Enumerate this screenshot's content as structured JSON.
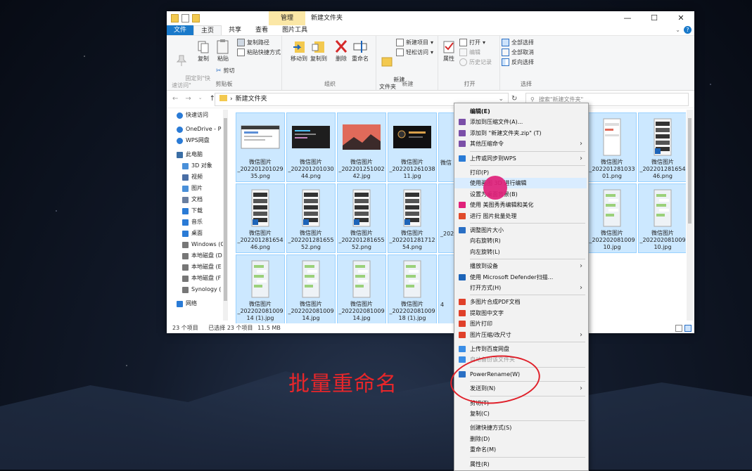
{
  "window": {
    "manage_tab": "管理",
    "title": "新建文件夹",
    "controls": [
      "—",
      "☐",
      "✕"
    ]
  },
  "tabs": {
    "file": "文件",
    "home": "主页",
    "share": "共享",
    "view": "查看",
    "picture_tools": "图片工具"
  },
  "ribbon": {
    "pin_quick": "固定到\"快\n速访问\"",
    "copy": "复制",
    "paste": "粘贴",
    "copy_path": "复制路径",
    "paste_shortcut": "粘贴快捷方式",
    "cut": "剪切",
    "clipboard_group": "剪贴板",
    "move_to": "移动到",
    "copy_to": "复制到",
    "delete": "删除",
    "rename": "重命名",
    "organize_group": "组织",
    "new_item": "新建项目",
    "easy_access": "轻松访问",
    "new_folder": "新建\n文件夹",
    "new_group": "新建",
    "properties": "属性",
    "open": "打开",
    "edit": "编辑",
    "history": "历史记录",
    "open_group": "打开",
    "select_all": "全部选择",
    "select_none": "全部取消",
    "invert_selection": "反向选择",
    "select_group": "选择"
  },
  "navbar": {
    "path": "新建文件夹",
    "search_placeholder": "搜索\"新建文件夹\""
  },
  "nav_pane": [
    {
      "label": "快速访问",
      "icon": "star-icon",
      "color": "#2a7bd6"
    },
    {
      "label": "OneDrive - P",
      "icon": "cloud-icon",
      "color": "#2a7bd6"
    },
    {
      "label": "WPS网盘",
      "icon": "cloud-icon",
      "color": "#2a7bd6"
    },
    {
      "label": "此电脑",
      "icon": "computer-icon",
      "color": "#3a6ea5"
    },
    {
      "label": "3D 对象",
      "icon": "cube-icon",
      "color": "#4a90d9"
    },
    {
      "label": "视频",
      "icon": "video-icon",
      "color": "#4a6ea5"
    },
    {
      "label": "图片",
      "icon": "picture-icon",
      "color": "#4a90d9"
    },
    {
      "label": "文档",
      "icon": "document-icon",
      "color": "#6a7fa0"
    },
    {
      "label": "下载",
      "icon": "download-icon",
      "color": "#2a7bd6"
    },
    {
      "label": "音乐",
      "icon": "music-icon",
      "color": "#2a7bd6"
    },
    {
      "label": "桌面",
      "icon": "desktop-icon",
      "color": "#2a7bd6"
    },
    {
      "label": "Windows (C",
      "icon": "drive-icon",
      "color": "#777"
    },
    {
      "label": "本地磁盘 (D",
      "icon": "drive-icon",
      "color": "#777"
    },
    {
      "label": "本地磁盘 (E",
      "icon": "drive-icon",
      "color": "#777"
    },
    {
      "label": "本地磁盘 (F",
      "icon": "drive-icon",
      "color": "#777"
    },
    {
      "label": "Synology (",
      "icon": "nas-icon",
      "color": "#777"
    },
    {
      "label": "网络",
      "icon": "network-icon",
      "color": "#2a7bd6"
    }
  ],
  "files": [
    {
      "name": "微信图片\n_202201201029\n35.png",
      "thumb": "screenshot"
    },
    {
      "name": "微信图片\n_202201201030\n44.png",
      "thumb": "dark"
    },
    {
      "name": "微信图片\n_202201251002\n42.jpg",
      "thumb": "red"
    },
    {
      "name": "微信图片\n_202201261038\n11.jpg",
      "thumb": "black"
    },
    {
      "name": "微信图片\n_202201281033\n01.png",
      "thumb": "phone-light"
    },
    {
      "name": "微信图片\n_202201281654\n46.png",
      "thumb": "phone-dark"
    },
    {
      "name": "微信图片\n_202201281654\n46.png",
      "thumb": "phone-dark"
    },
    {
      "name": "微信图片\n_202201281655\n52.png",
      "thumb": "phone-dark"
    },
    {
      "name": "微信图片\n_202201281655\n52.png",
      "thumb": "phone-dark"
    },
    {
      "name": "微信图片\n_202201281712\n54.png",
      "thumb": "phone-dark"
    },
    {
      "name": "微信图片\n_202202081009\n10.jpg",
      "thumb": "chat"
    },
    {
      "name": "微信图片\n_202202081009\n10.jpg",
      "thumb": "chat"
    },
    {
      "name": "微信图片\n_202202081009\n14 (1).jpg",
      "thumb": "chat"
    },
    {
      "name": "微信图片\n_202202081009\n14.jpg",
      "thumb": "chat"
    },
    {
      "name": "微信图片\n_202202081009\n14.jpg",
      "thumb": "chat"
    },
    {
      "name": "微信图片\n_202202081009\n18 (1).jpg",
      "thumb": "chat"
    }
  ],
  "partial_labels": [
    "微信",
    "_202",
    "4",
    "5",
    "_202"
  ],
  "status": {
    "count": "23 个项目",
    "selected": "已选择 23 个项目",
    "size": "11.5 MB"
  },
  "context_menu": [
    {
      "label": "编辑(E)",
      "bold": true
    },
    {
      "label": "添加到压缩文件(A)...",
      "icon": "archive-icon"
    },
    {
      "label": "添加到 \"新建文件夹.zip\" (T)",
      "icon": "archive-icon"
    },
    {
      "label": "其他压缩命令",
      "icon": "archive-icon",
      "submenu": true
    },
    {
      "sep": true
    },
    {
      "label": "上传或同步到WPS",
      "icon": "wps-cloud-icon",
      "submenu": true
    },
    {
      "sep": true
    },
    {
      "label": "打印(P)"
    },
    {
      "label": "使用画图 3D 进行编辑",
      "highlight": true
    },
    {
      "label": "设置为桌面背景(B)"
    },
    {
      "label": "使用 美图秀秀编辑和美化",
      "icon": "meitu-icon"
    },
    {
      "label": "进行 图片批量处理",
      "icon": "batch-icon"
    },
    {
      "sep": true
    },
    {
      "label": "调整图片大小",
      "icon": "resize-icon"
    },
    {
      "label": "向右旋转(R)"
    },
    {
      "label": "向左旋转(L)"
    },
    {
      "sep": true
    },
    {
      "label": "播放到设备",
      "submenu": true
    },
    {
      "label": "使用 Microsoft Defender扫描...",
      "icon": "shield-icon"
    },
    {
      "label": "打开方式(H)",
      "submenu": true
    },
    {
      "sep": true
    },
    {
      "label": "多图片合成PDF文档",
      "icon": "wps-icon"
    },
    {
      "label": "提取图中文字",
      "icon": "wps-icon"
    },
    {
      "label": "图片打印",
      "icon": "wps-icon"
    },
    {
      "label": "图片压缩/改尺寸",
      "icon": "wps-icon",
      "submenu": true
    },
    {
      "sep": true
    },
    {
      "label": "上传到百度网盘",
      "icon": "baidu-icon"
    },
    {
      "label": "自动备份该文件夹",
      "icon": "baidu-icon",
      "disabled": true
    },
    {
      "sep": true
    },
    {
      "label": "PowerRename(W)",
      "icon": "powerrename-icon"
    },
    {
      "sep": true
    },
    {
      "label": "发送到(N)",
      "submenu": true
    },
    {
      "sep": true
    },
    {
      "label": "剪切(T)"
    },
    {
      "label": "复制(C)"
    },
    {
      "sep": true
    },
    {
      "label": "创建快捷方式(S)"
    },
    {
      "label": "删除(D)"
    },
    {
      "label": "重命名(M)"
    },
    {
      "sep": true
    },
    {
      "label": "属性(R)"
    }
  ],
  "annotation": {
    "caption": "批量重命名",
    "color": "#e8262a"
  }
}
